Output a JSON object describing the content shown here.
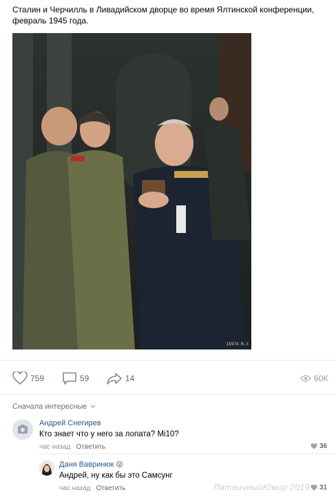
{
  "post": {
    "caption": "Сталин и Черчилль в Ливадийском дворце во время Ялтинской конференции, февраль 1945 года.",
    "photo_stamp": "15974 R-3"
  },
  "actions": {
    "likes": "759",
    "comments": "59",
    "shares": "14",
    "views": "60K"
  },
  "comments_section": {
    "sort_label": "Сначала интересные"
  },
  "comments": [
    {
      "author": "Андрей Снегирев",
      "text": "Кто знает что у него за лопата? Mi10?",
      "time": "час назад",
      "reply_label": "Ответить",
      "likes": "36"
    },
    {
      "author": "Даня Вавринюк",
      "author_emoji": "😜",
      "text": "Андрей, ну как бы это Самсунг",
      "time": "час назад",
      "reply_label": "Ответить",
      "likes": "31"
    }
  ],
  "watermark": "ПятничныйЮмор 2019"
}
